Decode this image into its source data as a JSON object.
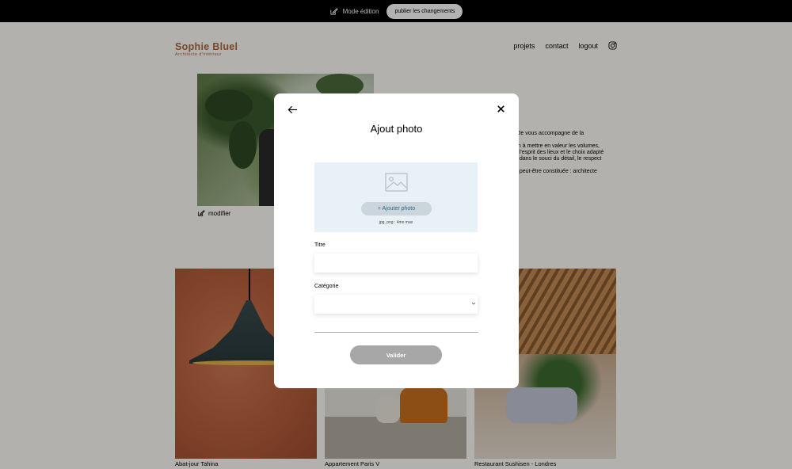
{
  "edit_bar": {
    "mode_label": "Mode édition",
    "publish_label": "publier les changements"
  },
  "header": {
    "logo_title": "Sophie Bluel",
    "logo_subtitle": "Architecte d'intérieur",
    "nav": [
      "projets",
      "contact",
      "logout"
    ],
    "instagram_icon": "instagram-icon"
  },
  "introduction": {
    "modify_label": "modifier",
    "text_lines": [
      ". Je vous accompagne de la",
      "on à mettre en valeur les volumes,",
      "e l'esprit des lieux et le choix adapté",
      "é dans le souci du détail, le respect",
      "e peut-être constituée : architecte"
    ]
  },
  "gallery": [
    {
      "caption": "Abat-jour Tahina"
    },
    {
      "caption": "Appartement Paris V"
    },
    {
      "caption": "Restaurant Sushisen - Londres"
    }
  ],
  "modal": {
    "title": "Ajout photo",
    "add_photo_label": "+ Ajouter photo",
    "upload_hint": "jpg, png : 4mo max",
    "title_label": "Titre",
    "title_value": "",
    "category_label": "Catégorie",
    "category_value": "",
    "validate_label": "Valider"
  },
  "colors": {
    "brand": "#b1663c",
    "upload_bg": "#e8f1f6",
    "add_photo_text": "#306685",
    "validate_disabled": "#a7a7a7"
  }
}
